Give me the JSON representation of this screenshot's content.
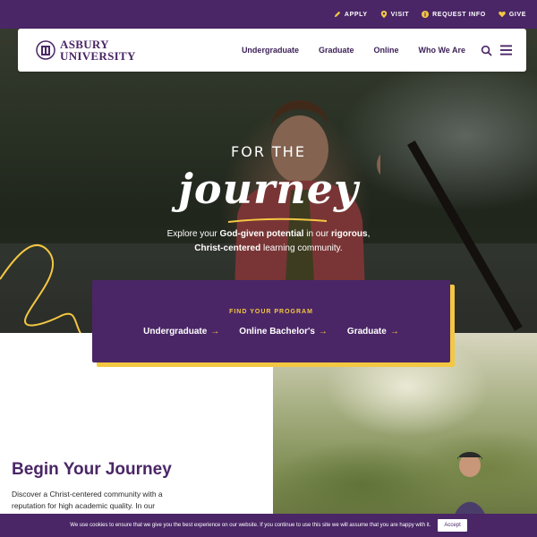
{
  "utility": {
    "links": [
      {
        "label": "APPLY",
        "icon": "pencil-icon"
      },
      {
        "label": "VISIT",
        "icon": "map-pin-icon"
      },
      {
        "label": "REQUEST INFO",
        "icon": "info-icon"
      },
      {
        "label": "GIVE",
        "icon": "heart-icon"
      }
    ]
  },
  "header": {
    "logo": {
      "line1": "ASBURY",
      "line2": "UNIVERSITY",
      "icon": "asbury-seal-icon"
    },
    "nav": [
      "Undergraduate",
      "Graduate",
      "Online",
      "Who We Are"
    ],
    "search_icon": "search-icon",
    "menu_icon": "hamburger-menu-icon"
  },
  "hero": {
    "eyebrow": "FOR THE",
    "script_title": "journey",
    "copy": {
      "part1": "Explore your ",
      "bold1": "God-given potential",
      "part2": " in our ",
      "bold2": "rigorous",
      "part3": ",",
      "bold3": "Christ-centered",
      "part4": " learning community."
    }
  },
  "program_finder": {
    "eyebrow": "FIND YOUR PROGRAM",
    "links": [
      {
        "label": "Undergraduate",
        "arrow": "→"
      },
      {
        "label": "Online Bachelor's",
        "arrow": "→"
      },
      {
        "label": "Graduate",
        "arrow": "→"
      }
    ]
  },
  "intro": {
    "title": "Begin Your Journey",
    "body": "Discover a Christ-centered community with a reputation for high academic quality. In our"
  },
  "cookie": {
    "text": "We use cookies to ensure that we give you the best experience on our website. If you continue to use this site we will assume that you are happy with it.",
    "accept": "Accept"
  },
  "colors": {
    "brand_purple": "#4a2666",
    "accent_gold": "#f3c742",
    "white": "#ffffff"
  }
}
